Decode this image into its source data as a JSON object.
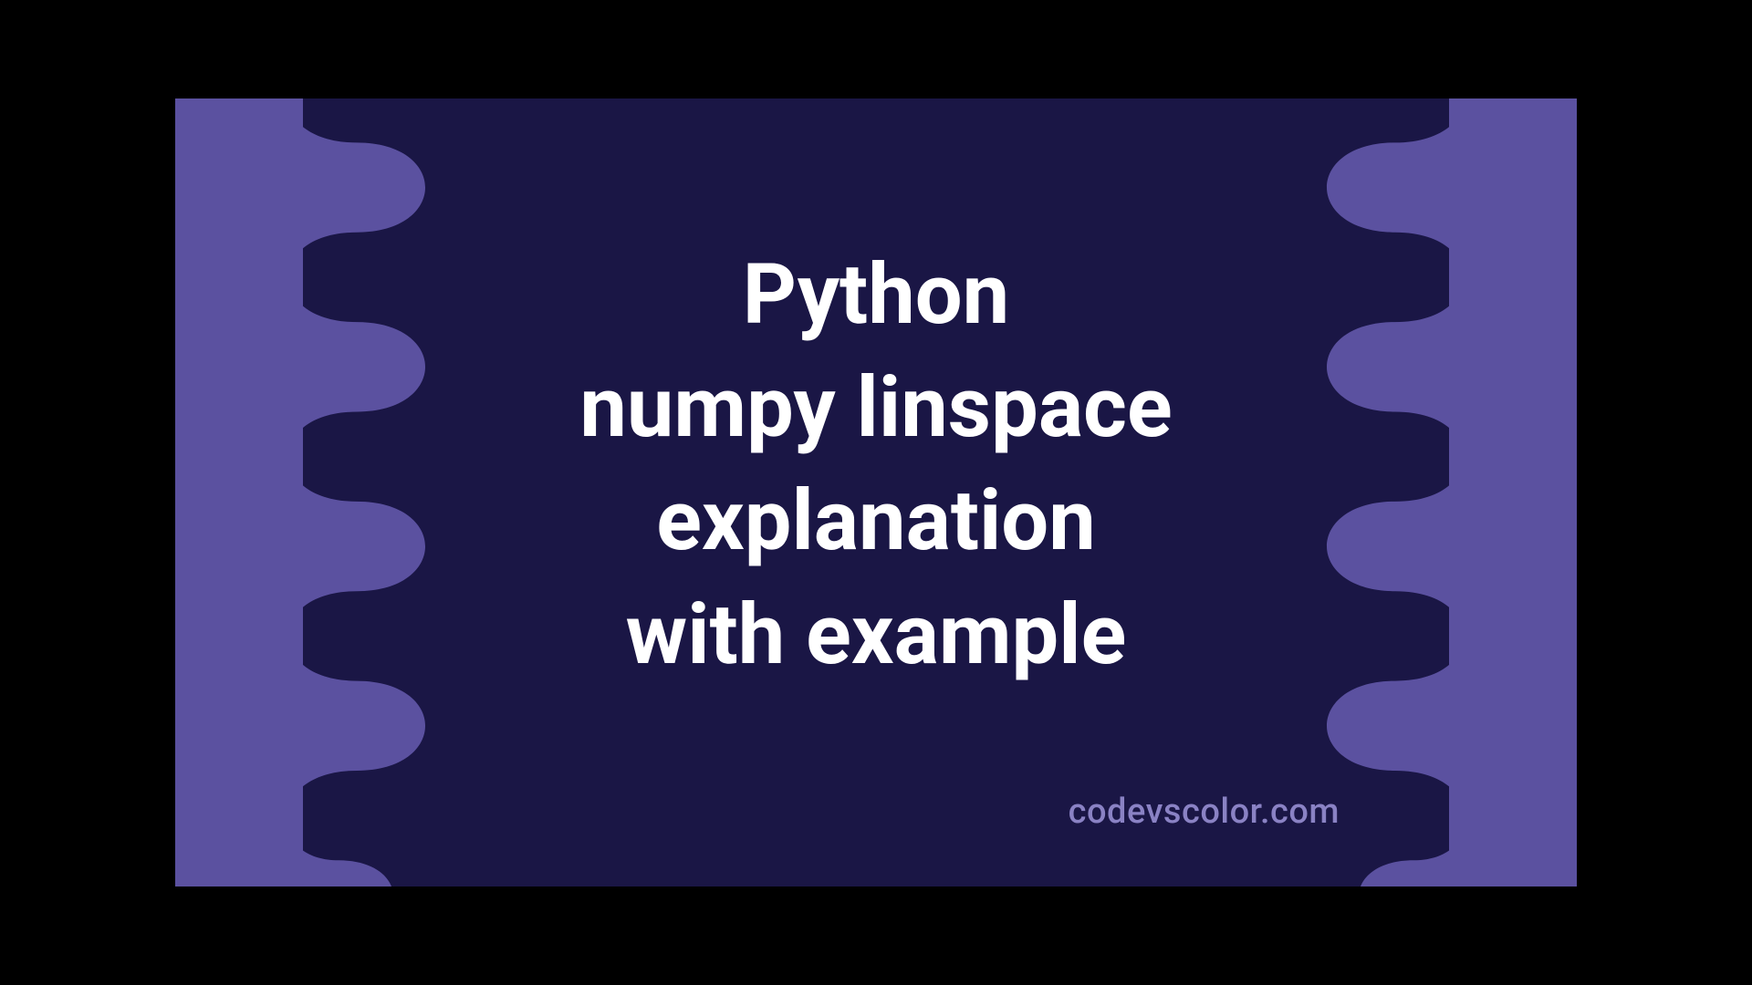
{
  "title": {
    "line1": "Python",
    "line2": "numpy linspace",
    "line3": "explanation",
    "line4": "with example"
  },
  "watermark": "codevscolor.com",
  "colors": {
    "bg_light": "#5b51a0",
    "bg_dark": "#1a1645",
    "text": "#ffffff",
    "watermark": "#8a82c4"
  }
}
